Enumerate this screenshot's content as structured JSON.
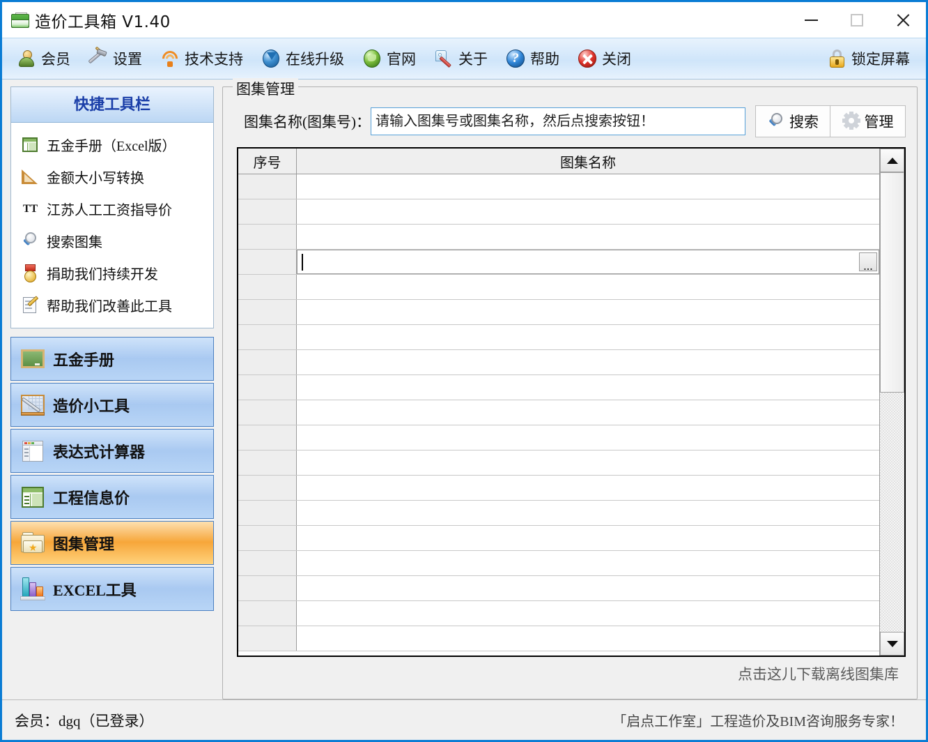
{
  "window": {
    "title": "造价工具箱 V1.40",
    "icon": "green-folder-icon",
    "controls": {
      "minimize": "−",
      "maximize": "□",
      "close": "✕"
    },
    "border_color": "#0a7cd4"
  },
  "toolbar": {
    "items": [
      {
        "label": "会员",
        "icon": "user-icon"
      },
      {
        "label": "设置",
        "icon": "tools-icon"
      },
      {
        "label": "技术支持",
        "icon": "support-icon"
      },
      {
        "label": "在线升级",
        "icon": "globe-update-icon"
      },
      {
        "label": "官网",
        "icon": "globe-green-icon"
      },
      {
        "label": "关于",
        "icon": "tag-pen-icon"
      },
      {
        "label": "帮助",
        "icon": "question-mark-icon"
      },
      {
        "label": "关闭",
        "icon": "red-close-icon"
      }
    ],
    "lock": {
      "label": "锁定屏幕",
      "icon": "lock-icon"
    }
  },
  "sidebar": {
    "quick_panel": {
      "header": "快捷工具栏",
      "items": [
        {
          "label": "五金手册（Excel版）",
          "icon": "excel-table-icon"
        },
        {
          "label": "金额大小写转换",
          "icon": "triangle-ruler-icon"
        },
        {
          "label": "江苏人工工资指导价",
          "icon": "tt-icon"
        },
        {
          "label": "搜索图集",
          "icon": "magnifier-icon"
        },
        {
          "label": "捐助我们持续开发",
          "icon": "medal-icon"
        },
        {
          "label": "帮助我们改善此工具",
          "icon": "note-pencil-icon"
        }
      ]
    },
    "nav_items": [
      {
        "label": "五金手册",
        "icon": "blackboard-icon",
        "selected": false
      },
      {
        "label": "造价小工具",
        "icon": "ruler-pen-icon",
        "selected": false
      },
      {
        "label": "表达式计算器",
        "icon": "window-icon",
        "selected": false
      },
      {
        "label": "工程信息价",
        "icon": "green-table-icon",
        "selected": false
      },
      {
        "label": "图集管理",
        "icon": "folder-star-icon",
        "selected": true
      },
      {
        "label": "EXCEL工具",
        "icon": "bar-chart-icon",
        "selected": false
      }
    ]
  },
  "main": {
    "groupbox_title": "图集管理",
    "search": {
      "label": "图集名称(图集号)：",
      "value": "",
      "placeholder": "请输入图集号或图集名称，然后点搜索按钮！",
      "search_button": "搜索",
      "manage_button": "管理"
    },
    "grid": {
      "columns": [
        "序号",
        "图集名称"
      ],
      "rows": [
        {
          "seq": "",
          "name": ""
        },
        {
          "seq": "",
          "name": ""
        },
        {
          "seq": "",
          "name": ""
        },
        {
          "seq": "",
          "name": "",
          "editing": true,
          "ellipsis": "..."
        },
        {
          "seq": "",
          "name": ""
        },
        {
          "seq": "",
          "name": ""
        },
        {
          "seq": "",
          "name": ""
        },
        {
          "seq": "",
          "name": ""
        },
        {
          "seq": "",
          "name": ""
        },
        {
          "seq": "",
          "name": ""
        },
        {
          "seq": "",
          "name": ""
        },
        {
          "seq": "",
          "name": ""
        },
        {
          "seq": "",
          "name": ""
        },
        {
          "seq": "",
          "name": ""
        },
        {
          "seq": "",
          "name": ""
        },
        {
          "seq": "",
          "name": ""
        },
        {
          "seq": "",
          "name": ""
        },
        {
          "seq": "",
          "name": ""
        },
        {
          "seq": "",
          "name": ""
        }
      ],
      "scroll": {
        "up": "▲",
        "down": "▼",
        "thumb_percent": 48
      }
    },
    "download_link": "点击这儿下载离线图集库"
  },
  "statusbar": {
    "member": "会员：dgq（已登录）",
    "slogan": "「启点工作室」工程造价及BIM咨询服务专家！"
  }
}
